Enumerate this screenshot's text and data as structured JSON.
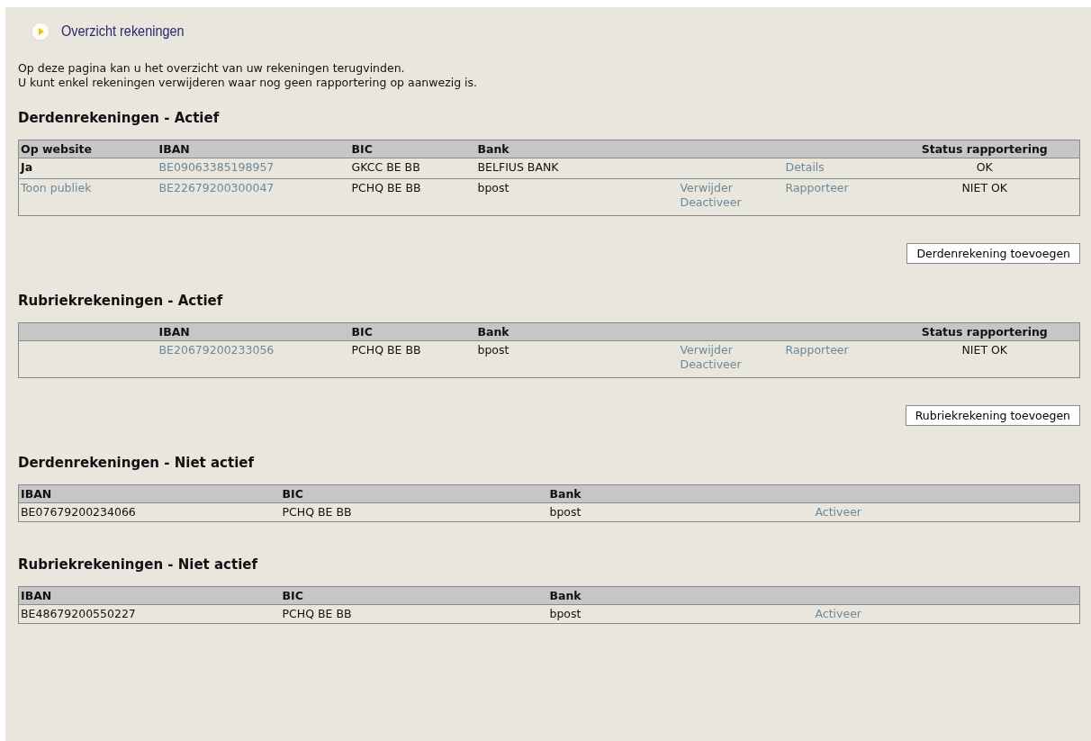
{
  "page_title": "Overzicht rekeningen",
  "intro": [
    "Op deze pagina kan u het overzicht van uw rekeningen terugvinden.",
    "U kunt enkel rekeningen verwijderen waar nog geen rapportering op aanwezig is."
  ],
  "sections": [
    {
      "heading": "Derdenrekeningen - Actief",
      "kind": "active",
      "columns": {
        "website": "Op website",
        "iban": "IBAN",
        "bic": "BIC",
        "bank": "Bank",
        "status": "Status rapportering"
      },
      "rows": [
        {
          "website": {
            "text": "Ja",
            "kind": "value"
          },
          "iban": "BE09063385198957",
          "bic": "GKCC BE BB",
          "bank": "BELFIUS BANK",
          "report_link": "Details",
          "status": "OK"
        },
        {
          "website": {
            "text": "Toon publiek",
            "kind": "link"
          },
          "iban": "BE22679200300047",
          "bic": "PCHQ BE BB",
          "bank": "bpost",
          "actions": [
            "Verwijder",
            "Deactiveer"
          ],
          "report_link": "Rapporteer",
          "status": "NIET OK"
        }
      ],
      "add_button": "Derdenrekening toevoegen"
    },
    {
      "heading": "Rubriekrekeningen - Actief",
      "kind": "active",
      "columns": {
        "iban": "IBAN",
        "bic": "BIC",
        "bank": "Bank",
        "status": "Status rapportering"
      },
      "rows": [
        {
          "iban": "BE20679200233056",
          "bic": "PCHQ BE BB",
          "bank": "bpost",
          "actions": [
            "Verwijder",
            "Deactiveer"
          ],
          "report_link": "Rapporteer",
          "status": "NIET OK"
        }
      ],
      "add_button": "Rubriekrekening toevoegen"
    },
    {
      "heading": "Derdenrekeningen - Niet actief",
      "kind": "inactive",
      "columns": {
        "iban": "IBAN",
        "bic": "BIC",
        "bank": "Bank"
      },
      "rows": [
        {
          "iban": "BE07679200234066",
          "bic": "PCHQ BE BB",
          "bank": "bpost",
          "action": "Activeer"
        }
      ]
    },
    {
      "heading": "Rubriekrekeningen - Niet actief",
      "kind": "inactive",
      "columns": {
        "iban": "IBAN",
        "bic": "BIC",
        "bank": "Bank"
      },
      "rows": [
        {
          "iban": "BE48679200550227",
          "bic": "PCHQ BE BB",
          "bank": "bpost",
          "action": "Activeer"
        }
      ]
    }
  ]
}
